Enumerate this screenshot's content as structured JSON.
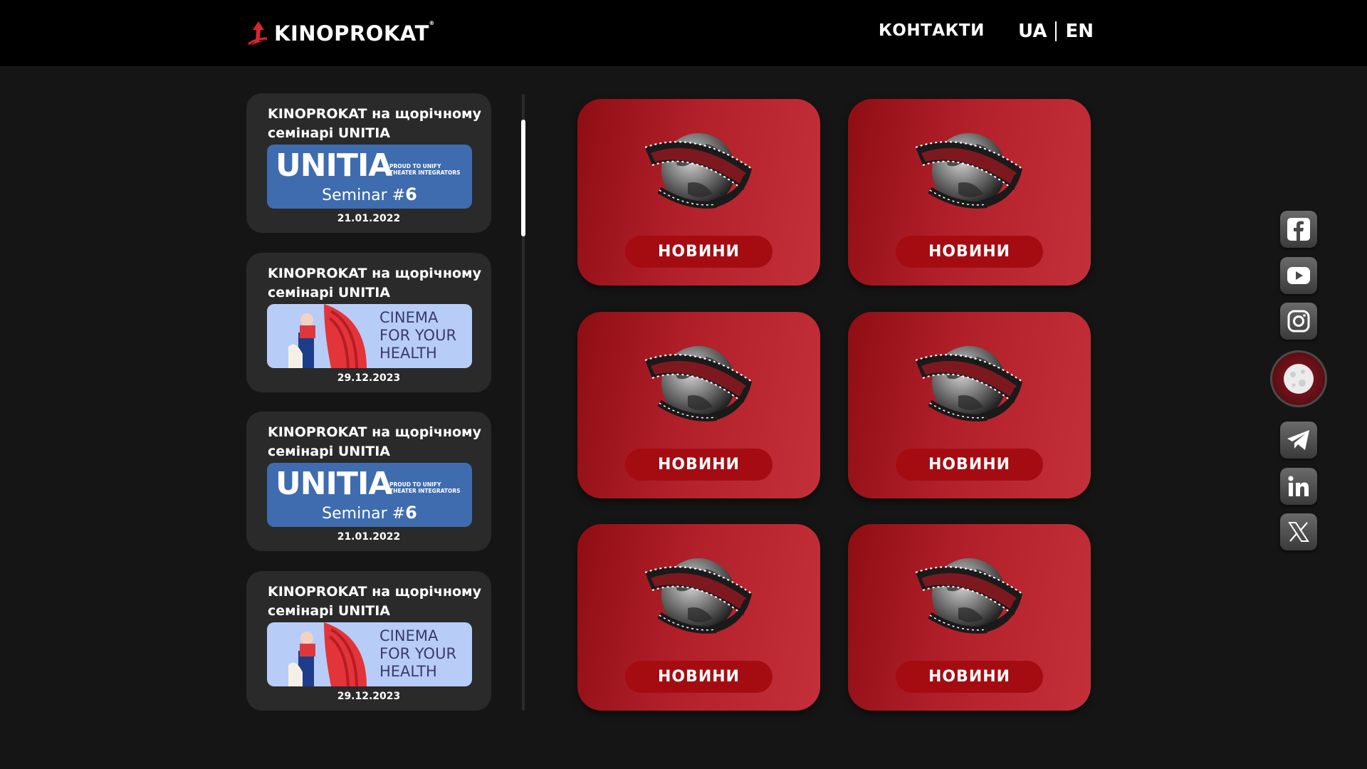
{
  "header": {
    "logo_text": "KINOPROKAT",
    "logo_reg": "®",
    "contacts": "КОНТАКТИ",
    "lang_ua": "UA",
    "lang_en": "EN"
  },
  "news": [
    {
      "title": "KINOPROKAT на щорічному семінарі UNITIA",
      "date": "21.01.2022",
      "banner": "unitia"
    },
    {
      "title": "KINOPROKAT на щорічному семінарі UNITIA",
      "date": "29.12.2023",
      "banner": "health"
    },
    {
      "title": "KINOPROKAT на щорічному семінарі UNITIA",
      "date": "21.01.2022",
      "banner": "unitia"
    },
    {
      "title": "KINOPROKAT на щорічному семінарі UNITIA",
      "date": "29.12.2023",
      "banner": "health"
    }
  ],
  "banners": {
    "unitia": {
      "logo": "UNITIA",
      "tag1": "PROUD TO UNIFY",
      "tag2": "THEATER INTEGRATORS",
      "seminar": "Seminar #",
      "number": "6"
    },
    "health": {
      "line1": "CINEMA",
      "line2": "FOR YOUR",
      "line3": "HEALTH"
    }
  },
  "tiles": [
    {
      "label": "НОВИНИ"
    },
    {
      "label": "НОВИНИ"
    },
    {
      "label": "НОВИНИ"
    },
    {
      "label": "НОВИНИ"
    },
    {
      "label": "НОВИНИ"
    },
    {
      "label": "НОВИНИ"
    }
  ],
  "social": [
    {
      "icon": "facebook-icon"
    },
    {
      "icon": "youtube-icon"
    },
    {
      "icon": "instagram-icon"
    },
    {
      "icon": "moon-icon"
    },
    {
      "icon": "telegram-icon"
    },
    {
      "icon": "linkedin-icon"
    },
    {
      "icon": "x-icon"
    }
  ],
  "colors": {
    "background": "#151515",
    "header": "#000000",
    "tile_red": "#b2202a",
    "button_red": "#a50c12",
    "card": "#2a2a2a"
  }
}
